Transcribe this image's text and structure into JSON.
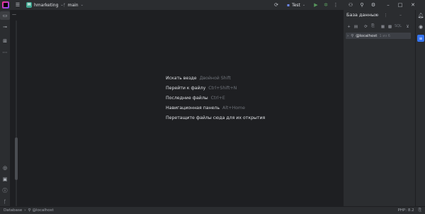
{
  "titlebar": {
    "project_badge": "H",
    "project_name": "hmarketing",
    "branch": "main",
    "run_config": "Test"
  },
  "editor": {
    "collapse_symbol": "—",
    "tips": [
      {
        "label": "Искать везде",
        "shortcut": "Двойной Shift"
      },
      {
        "label": "Перейти к файлу",
        "shortcut": "Ctrl+Shift+N"
      },
      {
        "label": "Последние файлы",
        "shortcut": "Ctrl+E"
      },
      {
        "label": "Навигационная панель",
        "shortcut": "Alt+Home"
      },
      {
        "label": "Перетащите файлы сюда для их открытия",
        "shortcut": ""
      }
    ]
  },
  "db_panel": {
    "title": "База данных",
    "sql_label": "SQL",
    "node_label": "@localhost",
    "node_count": "1 из 6"
  },
  "statusbar": {
    "crumb_root": "Database",
    "crumb_node": "@localhost",
    "php_version": "PHP: 8.2"
  },
  "colors": {
    "background": "#1e1f22",
    "panel": "#2b2d30",
    "accent": "#3574f0",
    "project_badge": "#3fa58f"
  }
}
